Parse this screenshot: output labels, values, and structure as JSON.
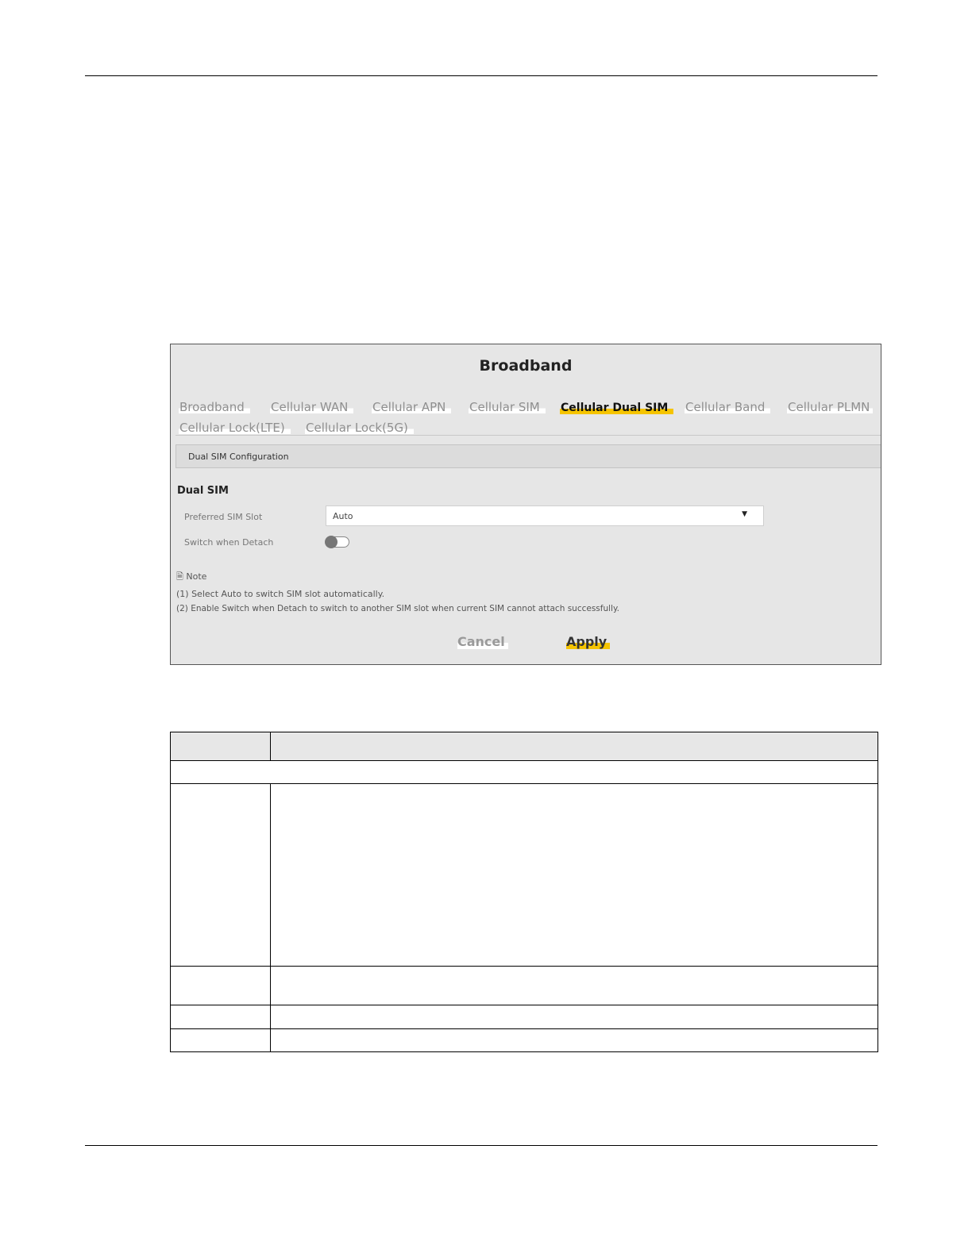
{
  "panel": {
    "title": "Broadband",
    "tabs": [
      {
        "label": "Broadband",
        "active": false
      },
      {
        "label": "Cellular WAN",
        "active": false
      },
      {
        "label": "Cellular APN",
        "active": false
      },
      {
        "label": "Cellular SIM",
        "active": false
      },
      {
        "label": "Cellular Dual SIM",
        "active": true
      },
      {
        "label": "Cellular Band",
        "active": false
      },
      {
        "label": "Cellular PLMN",
        "active": false
      },
      {
        "label": "Cellular Lock(LTE)",
        "active": false
      },
      {
        "label": "Cellular Lock(5G)",
        "active": false
      }
    ],
    "section": "Dual SIM Configuration",
    "heading": "Dual SIM",
    "preferred_label": "Preferred SIM Slot",
    "preferred_value": "Auto",
    "switch_label": "Switch when Detach",
    "switch_on": false,
    "note_title": "Note",
    "note_lines": [
      "(1) Select Auto to switch SIM slot automatically.",
      "(2) Enable Switch when Detach to switch to another SIM slot when current SIM cannot attach successfully."
    ],
    "cancel_label": "Cancel",
    "apply_label": "Apply"
  },
  "colors": {
    "accent": "#f5c400",
    "panel_bg": "#e6e6e6"
  }
}
